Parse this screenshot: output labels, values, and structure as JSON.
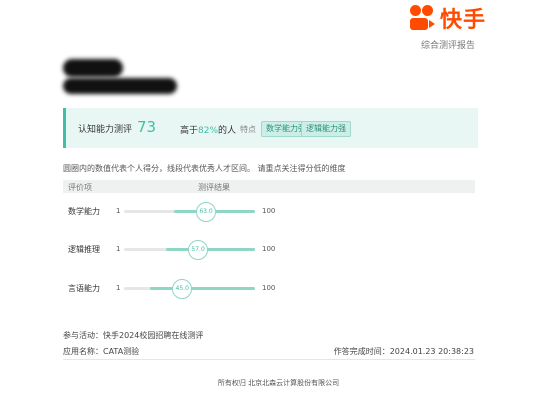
{
  "brand": {
    "name": "快手",
    "color": "#ff4b00",
    "icon": "kuaishou-logo"
  },
  "header": {
    "report_label": "综合测评报告"
  },
  "summary": {
    "title": "认知能力测评",
    "score": "73",
    "percentile_prefix": "高于",
    "percentile_value": "82%",
    "percentile_suffix": "的人",
    "feature_label": "特点",
    "tags": [
      "数学能力强",
      "逻辑能力强"
    ]
  },
  "description": "圆圈内的数值代表个人得分，线段代表优秀人才区间。 请重点关注得分低的维度",
  "table": {
    "headers": [
      "评价项",
      "测评结果"
    ],
    "rows": [
      {
        "label": "数学能力",
        "min": "1",
        "max": "100",
        "score": "63.0",
        "score_value": 63.0
      },
      {
        "label": "逻辑推理",
        "min": "1",
        "max": "100",
        "score": "57.0",
        "score_value": 57.0
      },
      {
        "label": "言语能力",
        "min": "1",
        "max": "100",
        "score": "45.0",
        "score_value": 45.0
      }
    ]
  },
  "footer": {
    "activity": "参与活动：快手2024校园招聘在线测评",
    "app": "应用名称：CATA测验",
    "time": "作答完成时间：2024.01.23 20:38:23",
    "copyright": "所有权归 北京北森云计算股份有限公司"
  },
  "colors": {
    "accent": "#3fbfa6",
    "accent_light": "#8fd6c5",
    "tag_bg": "#cdeee7"
  }
}
